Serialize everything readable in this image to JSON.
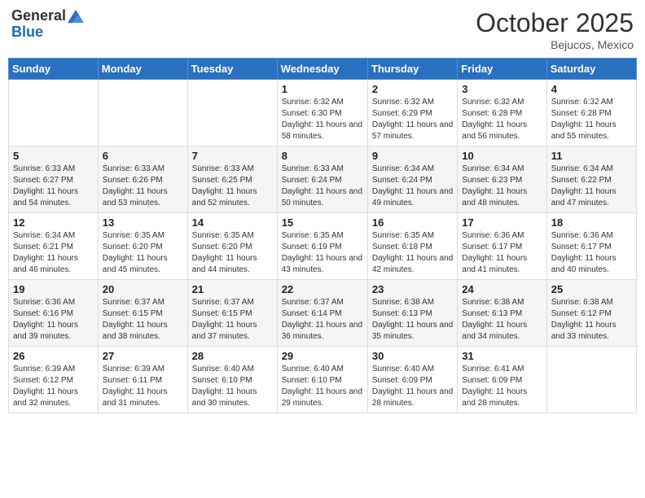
{
  "logo": {
    "general": "General",
    "blue": "Blue"
  },
  "header": {
    "month": "October 2025",
    "location": "Bejucos, Mexico"
  },
  "weekdays": [
    "Sunday",
    "Monday",
    "Tuesday",
    "Wednesday",
    "Thursday",
    "Friday",
    "Saturday"
  ],
  "weeks": [
    [
      {
        "day": "",
        "info": ""
      },
      {
        "day": "",
        "info": ""
      },
      {
        "day": "",
        "info": ""
      },
      {
        "day": "1",
        "info": "Sunrise: 6:32 AM\nSunset: 6:30 PM\nDaylight: 11 hours and 58 minutes."
      },
      {
        "day": "2",
        "info": "Sunrise: 6:32 AM\nSunset: 6:29 PM\nDaylight: 11 hours and 57 minutes."
      },
      {
        "day": "3",
        "info": "Sunrise: 6:32 AM\nSunset: 6:28 PM\nDaylight: 11 hours and 56 minutes."
      },
      {
        "day": "4",
        "info": "Sunrise: 6:32 AM\nSunset: 6:28 PM\nDaylight: 11 hours and 55 minutes."
      }
    ],
    [
      {
        "day": "5",
        "info": "Sunrise: 6:33 AM\nSunset: 6:27 PM\nDaylight: 11 hours and 54 minutes."
      },
      {
        "day": "6",
        "info": "Sunrise: 6:33 AM\nSunset: 6:26 PM\nDaylight: 11 hours and 53 minutes."
      },
      {
        "day": "7",
        "info": "Sunrise: 6:33 AM\nSunset: 6:25 PM\nDaylight: 11 hours and 52 minutes."
      },
      {
        "day": "8",
        "info": "Sunrise: 6:33 AM\nSunset: 6:24 PM\nDaylight: 11 hours and 50 minutes."
      },
      {
        "day": "9",
        "info": "Sunrise: 6:34 AM\nSunset: 6:24 PM\nDaylight: 11 hours and 49 minutes."
      },
      {
        "day": "10",
        "info": "Sunrise: 6:34 AM\nSunset: 6:23 PM\nDaylight: 11 hours and 48 minutes."
      },
      {
        "day": "11",
        "info": "Sunrise: 6:34 AM\nSunset: 6:22 PM\nDaylight: 11 hours and 47 minutes."
      }
    ],
    [
      {
        "day": "12",
        "info": "Sunrise: 6:34 AM\nSunset: 6:21 PM\nDaylight: 11 hours and 46 minutes."
      },
      {
        "day": "13",
        "info": "Sunrise: 6:35 AM\nSunset: 6:20 PM\nDaylight: 11 hours and 45 minutes."
      },
      {
        "day": "14",
        "info": "Sunrise: 6:35 AM\nSunset: 6:20 PM\nDaylight: 11 hours and 44 minutes."
      },
      {
        "day": "15",
        "info": "Sunrise: 6:35 AM\nSunset: 6:19 PM\nDaylight: 11 hours and 43 minutes."
      },
      {
        "day": "16",
        "info": "Sunrise: 6:35 AM\nSunset: 6:18 PM\nDaylight: 11 hours and 42 minutes."
      },
      {
        "day": "17",
        "info": "Sunrise: 6:36 AM\nSunset: 6:17 PM\nDaylight: 11 hours and 41 minutes."
      },
      {
        "day": "18",
        "info": "Sunrise: 6:36 AM\nSunset: 6:17 PM\nDaylight: 11 hours and 40 minutes."
      }
    ],
    [
      {
        "day": "19",
        "info": "Sunrise: 6:36 AM\nSunset: 6:16 PM\nDaylight: 11 hours and 39 minutes."
      },
      {
        "day": "20",
        "info": "Sunrise: 6:37 AM\nSunset: 6:15 PM\nDaylight: 11 hours and 38 minutes."
      },
      {
        "day": "21",
        "info": "Sunrise: 6:37 AM\nSunset: 6:15 PM\nDaylight: 11 hours and 37 minutes."
      },
      {
        "day": "22",
        "info": "Sunrise: 6:37 AM\nSunset: 6:14 PM\nDaylight: 11 hours and 36 minutes."
      },
      {
        "day": "23",
        "info": "Sunrise: 6:38 AM\nSunset: 6:13 PM\nDaylight: 11 hours and 35 minutes."
      },
      {
        "day": "24",
        "info": "Sunrise: 6:38 AM\nSunset: 6:13 PM\nDaylight: 11 hours and 34 minutes."
      },
      {
        "day": "25",
        "info": "Sunrise: 6:38 AM\nSunset: 6:12 PM\nDaylight: 11 hours and 33 minutes."
      }
    ],
    [
      {
        "day": "26",
        "info": "Sunrise: 6:39 AM\nSunset: 6:12 PM\nDaylight: 11 hours and 32 minutes."
      },
      {
        "day": "27",
        "info": "Sunrise: 6:39 AM\nSunset: 6:11 PM\nDaylight: 11 hours and 31 minutes."
      },
      {
        "day": "28",
        "info": "Sunrise: 6:40 AM\nSunset: 6:10 PM\nDaylight: 11 hours and 30 minutes."
      },
      {
        "day": "29",
        "info": "Sunrise: 6:40 AM\nSunset: 6:10 PM\nDaylight: 11 hours and 29 minutes."
      },
      {
        "day": "30",
        "info": "Sunrise: 6:40 AM\nSunset: 6:09 PM\nDaylight: 11 hours and 28 minutes."
      },
      {
        "day": "31",
        "info": "Sunrise: 6:41 AM\nSunset: 6:09 PM\nDaylight: 11 hours and 28 minutes."
      },
      {
        "day": "",
        "info": ""
      }
    ]
  ]
}
